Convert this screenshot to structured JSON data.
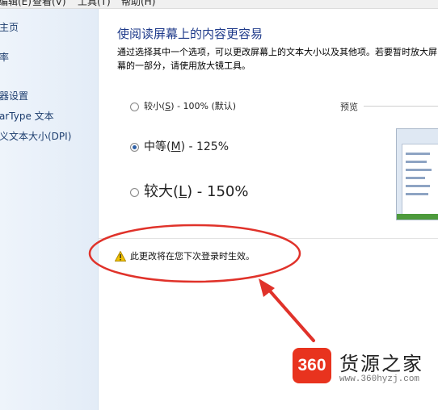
{
  "menubar": {
    "items": [
      "编辑(E)",
      "查看(V)",
      "工具(T)",
      "帮助(H)"
    ]
  },
  "sidebar": {
    "items": [
      {
        "label": "主页"
      },
      {
        "label": "率"
      },
      {
        "label": "器设置"
      },
      {
        "label": "arType 文本"
      },
      {
        "label": "义文本大小(DPI)"
      }
    ]
  },
  "main": {
    "title": "使阅读屏幕上的内容更容易",
    "description": "通过选择其中一个选项，可以更改屏幕上的文本大小以及其他项。若要暂时放大屏幕的一部分，请使用放大镜工具。",
    "options": [
      {
        "pre": "较小(",
        "key": "S",
        "post": ") - 100% (默认)",
        "selected": false
      },
      {
        "pre": "中等(",
        "key": "M",
        "post": ") - 125%",
        "selected": true
      },
      {
        "pre": "较大(",
        "key": "L",
        "post": ") - 150%",
        "selected": false
      }
    ],
    "preview_label": "预览",
    "warning": "此更改将在您下次登录时生效。"
  },
  "watermark": {
    "badge": "360",
    "name": "货源之家",
    "url": "www.360hyzj.com"
  },
  "colors": {
    "accent": "#1e3a8a",
    "annotation_red": "#e0322a",
    "warning_yellow": "#f2c200",
    "badge_red": "#e8331e"
  }
}
